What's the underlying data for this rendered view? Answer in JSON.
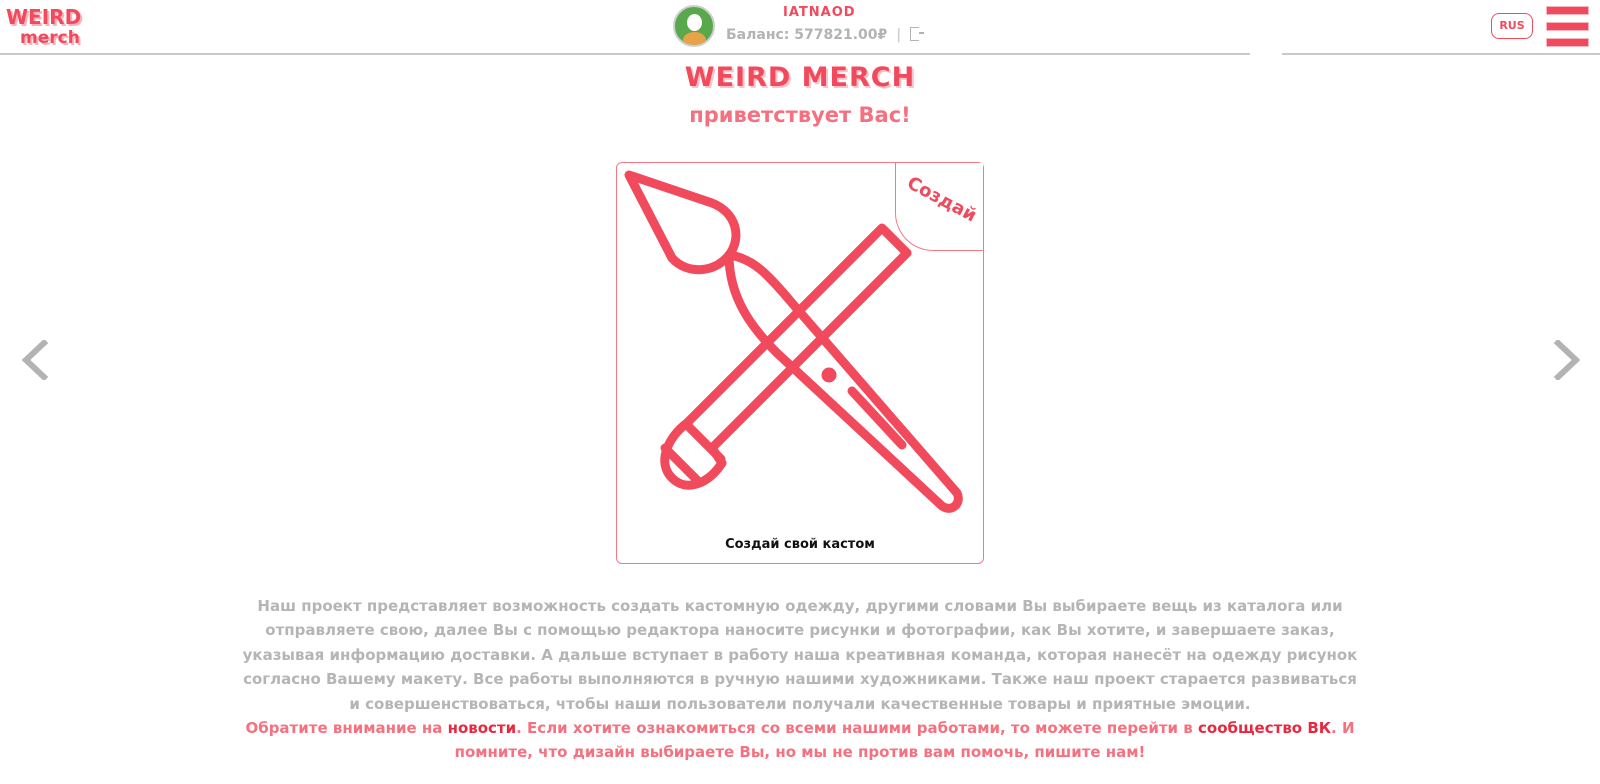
{
  "brand": {
    "line1": "WEIRD",
    "line2": "merch"
  },
  "header": {
    "username": "IATNAOD",
    "balance_label": "Баланс:",
    "balance_value": "577821.00₽",
    "separator": "|",
    "lang": "RUS"
  },
  "hero": {
    "title": "WEIRD MERCH",
    "subtitle": "приветствует Вас!"
  },
  "card": {
    "corner_label": "Создай",
    "caption": "Создай свой кастом",
    "icon": "paintbrush-pencil-cross-icon"
  },
  "description": "Наш проект представляет возможность создать кастомную одежду, другими словами Вы выбираете вещь из каталога или отправляете свою, далее Вы с помощью редактора наносите рисунки и фотографии, как Вы хотите, и завершаете заказ, указывая информацию доставки. А дальше вступает в работу наша креативная команда, которая нанесёт на одежду рисунок согласно Вашему макету. Все работы выполняются в ручную нашими художниками. Также наш проект старается развиваться и совершенствоваться, чтобы наши пользователи получали качественные товары и приятные эмоции.",
  "notice": {
    "part1": "Обратите внимание на ",
    "news_link": "новости",
    "part2": ". Если хотите ознакомиться со всеми нашими работами, то можете перейти в ",
    "vk_link": "сообщество ВК",
    "part3": ". И помните, что дизайн выбираете Вы, но мы не против вам помочь, пишите нам!"
  },
  "colors": {
    "accent": "#f04a5c",
    "muted": "#b5b5b5",
    "arrow": "#b3b3b3"
  }
}
